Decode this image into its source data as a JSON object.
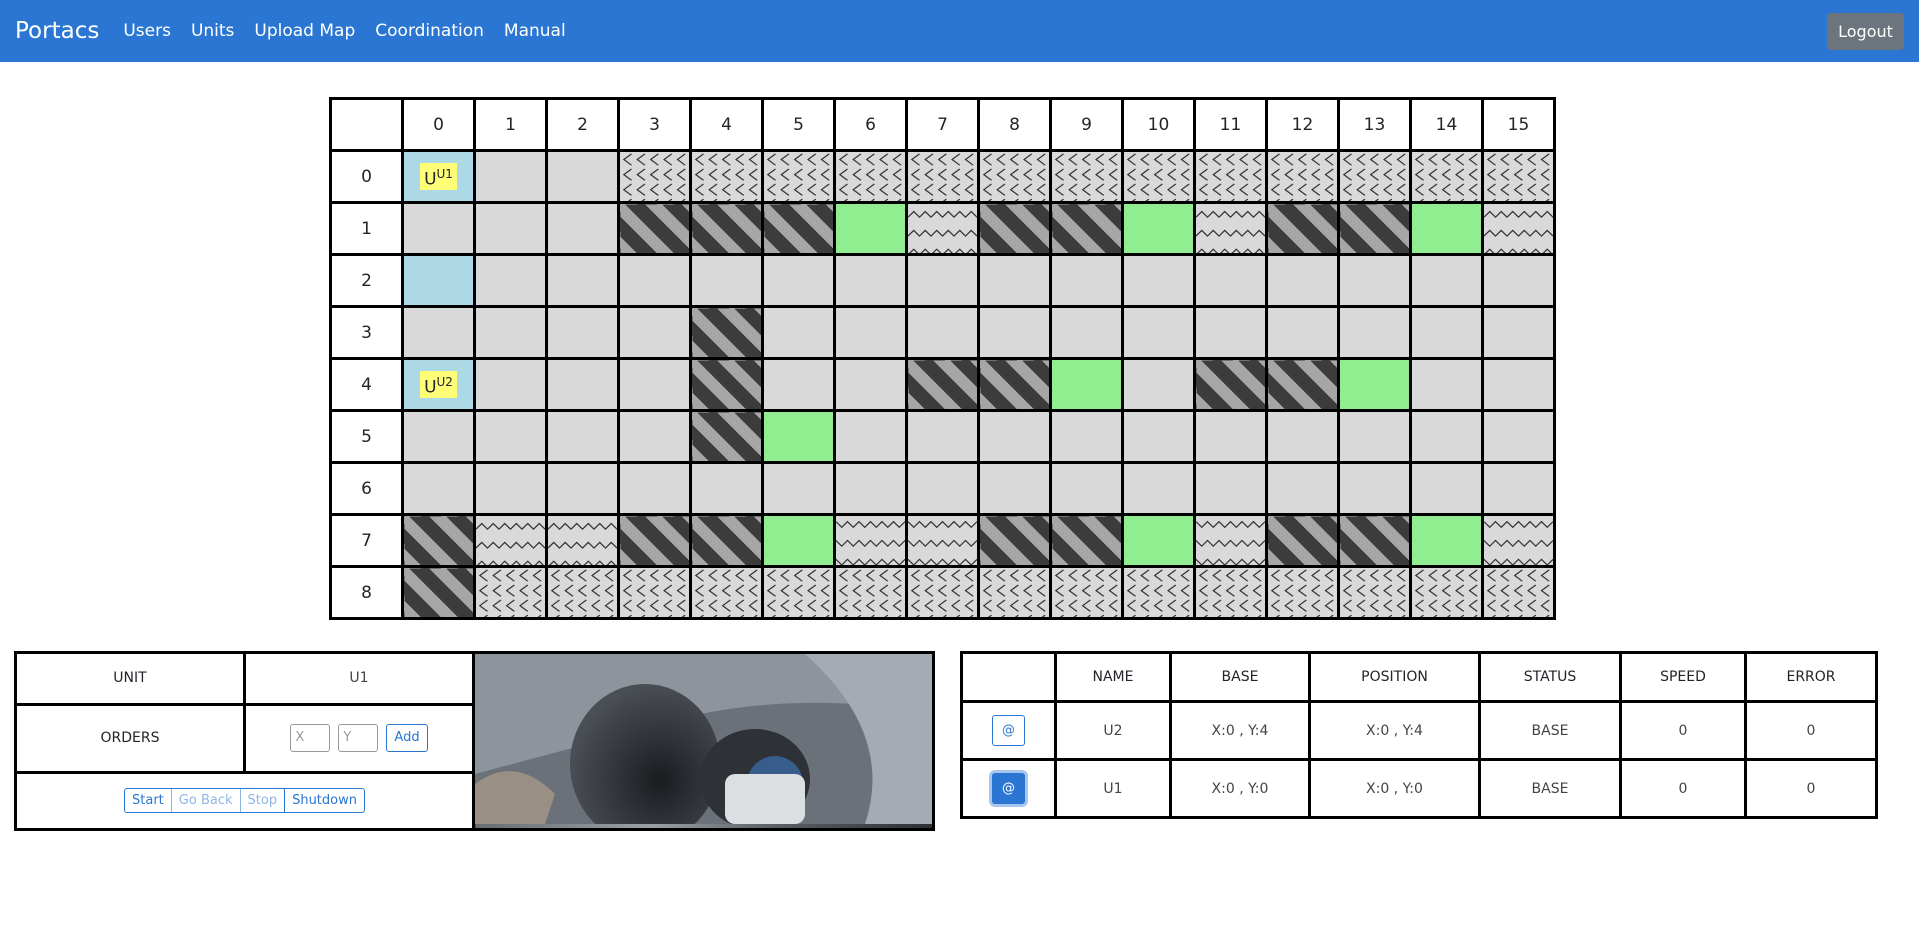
{
  "nav": {
    "brand": "Portacs",
    "links": [
      "Users",
      "Units",
      "Upload Map",
      "Coordination",
      "Manual"
    ],
    "logout": "Logout"
  },
  "map": {
    "cols": [
      "0",
      "1",
      "2",
      "3",
      "4",
      "5",
      "6",
      "7",
      "8",
      "9",
      "10",
      "11",
      "12",
      "13",
      "14",
      "15"
    ],
    "rows": [
      "0",
      "1",
      "2",
      "3",
      "4",
      "5",
      "6",
      "7",
      "8"
    ],
    "legend_colors": {
      "empty": "#d9d9d9",
      "base": "#add8e6",
      "green": "#90ee90",
      "unit": "#ffff77"
    },
    "cells": [
      [
        "base-u1",
        "e",
        "e",
        "zl",
        "zl",
        "zl",
        "zl",
        "zl",
        "zl",
        "zl",
        "zl",
        "zl",
        "zl",
        "zl",
        "zl",
        "zl"
      ],
      [
        "e",
        "e",
        "e",
        "s",
        "s",
        "s",
        "g",
        "zu",
        "s",
        "s",
        "g",
        "zu",
        "s",
        "s",
        "g",
        "zu"
      ],
      [
        "base",
        "e",
        "e",
        "e",
        "e",
        "e",
        "e",
        "e",
        "e",
        "e",
        "e",
        "e",
        "e",
        "e",
        "e",
        "e"
      ],
      [
        "e",
        "e",
        "e",
        "e",
        "s",
        "e",
        "e",
        "e",
        "e",
        "e",
        "e",
        "e",
        "e",
        "e",
        "e",
        "e"
      ],
      [
        "base-u2",
        "e",
        "e",
        "e",
        "s",
        "e",
        "e",
        "s",
        "s",
        "g",
        "e",
        "s",
        "s",
        "g",
        "e",
        "e"
      ],
      [
        "e",
        "e",
        "e",
        "e",
        "s",
        "g",
        "e",
        "e",
        "e",
        "e",
        "e",
        "e",
        "e",
        "e",
        "e",
        "e"
      ],
      [
        "e",
        "e",
        "e",
        "e",
        "e",
        "e",
        "e",
        "e",
        "e",
        "e",
        "e",
        "e",
        "e",
        "e",
        "e",
        "e"
      ],
      [
        "s",
        "zu",
        "zu",
        "s",
        "s",
        "g",
        "zd",
        "zd",
        "s",
        "s",
        "g",
        "zd",
        "s",
        "s",
        "g",
        "zd"
      ],
      [
        "s",
        "zl",
        "zl",
        "zl",
        "zl",
        "zl",
        "zl",
        "zl",
        "zl",
        "zl",
        "zl",
        "zl",
        "zl",
        "zl",
        "zl",
        "zl"
      ]
    ],
    "units": {
      "base-u1": "U1",
      "base-u2": "U2"
    },
    "unit_letter": "U"
  },
  "control": {
    "unit_label": "UNIT",
    "unit_value": "U1",
    "orders_label": "ORDERS",
    "x_placeholder": "X",
    "y_placeholder": "Y",
    "add": "Add",
    "buttons": [
      "Start",
      "Go Back",
      "Stop",
      "Shutdown"
    ]
  },
  "unit_table": {
    "headers": [
      "",
      "NAME",
      "BASE",
      "POSITION",
      "STATUS",
      "SPEED",
      "ERROR"
    ],
    "select_label": "@",
    "rows": [
      {
        "name": "U2",
        "base": "X:0 , Y:4",
        "position": "X:0 , Y:4",
        "status": "BASE",
        "speed": "0",
        "error": "0"
      },
      {
        "name": "U1",
        "base": "X:0 , Y:0",
        "position": "X:0 , Y:0",
        "status": "BASE",
        "speed": "0",
        "error": "0"
      }
    ]
  }
}
